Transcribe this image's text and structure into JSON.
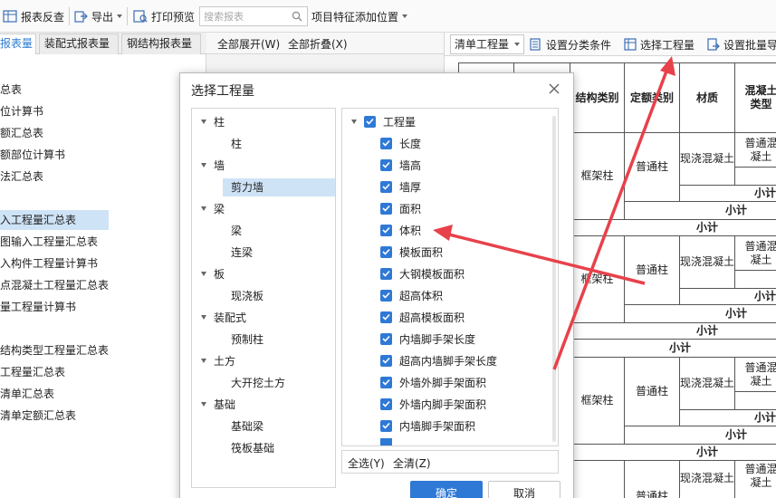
{
  "toolbar": {
    "report_check": "报表反查",
    "export": "导出",
    "print_preview": "打印预览",
    "search_placeholder": "搜索报表",
    "feature_position": "项目特征添加位置"
  },
  "left_tabs": [
    "报表量",
    "装配式报表量",
    "钢结构报表量"
  ],
  "left_items": [
    "总表",
    "位计算书",
    "额汇总表",
    "额部位计算书",
    "法汇总表",
    "入工程量汇总表",
    "图输入工程量汇总表",
    "入构件工程量计算书",
    "点混凝土工程量汇总表",
    "量工程量计算书",
    "结构类型工程量汇总表",
    "工程量汇总表",
    "清单汇总表",
    "清单定额汇总表"
  ],
  "mid_header": {
    "expand_all": "全部展开(W)",
    "collapse_all": "全部折叠(X)"
  },
  "right_toolbar": {
    "select_value": "清单工程量",
    "set_condition": "设置分类条件",
    "select_quantity": "选择工程量",
    "set_batch": "设置批量导"
  },
  "table": {
    "headers": [
      "结构类别",
      "定额类别",
      "材质",
      "混凝土类型"
    ],
    "col1": "框架柱",
    "col2": "普通柱",
    "col3": "现浇混凝土",
    "col4": "普通混凝土",
    "subtotal": "小计"
  },
  "dialog": {
    "title": "选择工程量",
    "tree": [
      {
        "label": "柱",
        "children": [
          "柱"
        ]
      },
      {
        "label": "墙",
        "children": [
          "剪力墙"
        ]
      },
      {
        "label": "梁",
        "children": [
          "梁",
          "连梁"
        ]
      },
      {
        "label": "板",
        "children": [
          "现浇板"
        ]
      },
      {
        "label": "装配式",
        "children": [
          "预制柱"
        ]
      },
      {
        "label": "土方",
        "children": [
          "大开挖土方"
        ]
      },
      {
        "label": "基础",
        "children": [
          "基础梁",
          "筏板基础"
        ]
      }
    ],
    "root_label": "工程量",
    "quantities": [
      "长度",
      "墙高",
      "墙厚",
      "面积",
      "体积",
      "模板面积",
      "大钢模板面积",
      "超高体积",
      "超高模板面积",
      "内墙脚手架长度",
      "超高内墙脚手架长度",
      "外墙外脚手架面积",
      "外墙内脚手架面积",
      "内墙脚手架面积"
    ],
    "select_all": "全选(Y)",
    "clear_all": "全清(Z)",
    "ok": "确定",
    "cancel": "取消"
  },
  "colors": {
    "accent": "#2f79d6",
    "selection": "#cfe3f7",
    "annotation": "#e8414a"
  }
}
